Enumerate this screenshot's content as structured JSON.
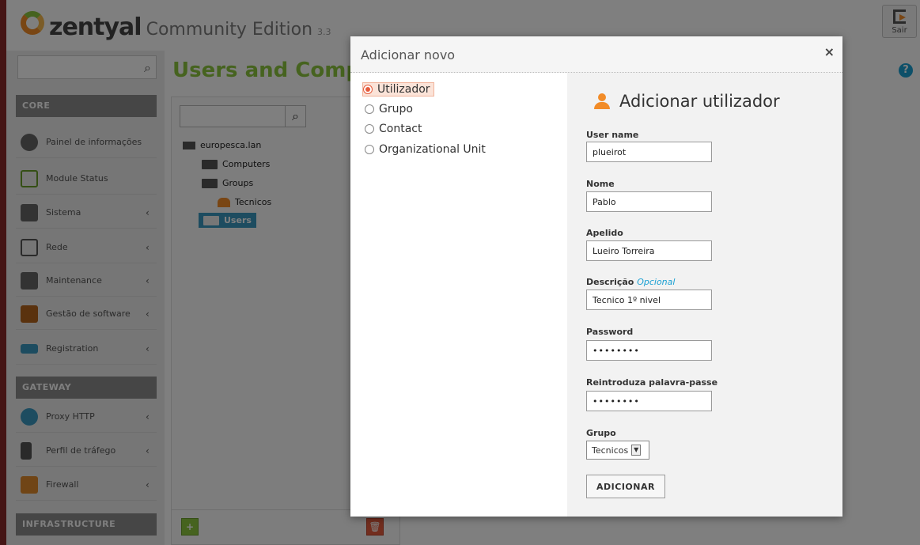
{
  "header": {
    "logo_word": "zentyal",
    "edition": "Community Edition",
    "version": "3.3",
    "logout_label": "Sair"
  },
  "sidebar": {
    "sections": [
      {
        "label": "CORE"
      },
      {
        "label": "GATEWAY"
      },
      {
        "label": "INFRASTRUCTURE"
      }
    ],
    "items": [
      {
        "label": "Painel de informações",
        "icon": "dashboard-icon",
        "has_submenu": false
      },
      {
        "label": "Module Status",
        "icon": "module-status-icon",
        "has_submenu": false
      },
      {
        "label": "Sistema",
        "icon": "gear-icon",
        "has_submenu": true
      },
      {
        "label": "Rede",
        "icon": "network-icon",
        "has_submenu": true
      },
      {
        "label": "Maintenance",
        "icon": "tools-icon",
        "has_submenu": true
      },
      {
        "label": "Gestão de software",
        "icon": "package-icon",
        "has_submenu": true
      },
      {
        "label": "Registration",
        "icon": "registration-icon",
        "has_submenu": true
      },
      {
        "label": "Proxy HTTP",
        "icon": "proxy-icon",
        "has_submenu": true
      },
      {
        "label": "Perfil de tráfego",
        "icon": "traffic-light-icon",
        "has_submenu": true
      },
      {
        "label": "Firewall",
        "icon": "firewall-icon",
        "has_submenu": true
      }
    ],
    "chevron": "‹"
  },
  "main": {
    "title": "Users and Compu",
    "tree": [
      {
        "label": "europesca.lan"
      },
      {
        "label": "Computers"
      },
      {
        "label": "Groups"
      },
      {
        "label": "Tecnicos"
      },
      {
        "label": "Users"
      }
    ]
  },
  "modal": {
    "title": "Adicionar novo",
    "close": "×",
    "types": [
      {
        "label": "Utilizador",
        "checked": true
      },
      {
        "label": "Grupo",
        "checked": false
      },
      {
        "label": "Contact",
        "checked": false
      },
      {
        "label": "Organizational Unit",
        "checked": false
      }
    ],
    "form_title": "Adicionar utilizador",
    "fields": {
      "username": {
        "label": "User name",
        "value": "plueirot"
      },
      "name": {
        "label": "Nome",
        "value": "Pablo"
      },
      "surname": {
        "label": "Apelido",
        "value": "Lueiro Torreira"
      },
      "description": {
        "label": "Descrição",
        "optional": "Opcional",
        "value": "Tecnico 1º nivel"
      },
      "password": {
        "label": "Password",
        "value": "••••••••"
      },
      "password2": {
        "label": "Reintroduza palavra-passe",
        "value": "••••••••"
      },
      "group": {
        "label": "Grupo",
        "value": "Tecnicos"
      }
    },
    "submit": "ADICIONAR"
  },
  "colors": {
    "accent_green": "#8dc63f",
    "accent_orange": "#f28c28",
    "selection_blue": "#3a99c0"
  }
}
